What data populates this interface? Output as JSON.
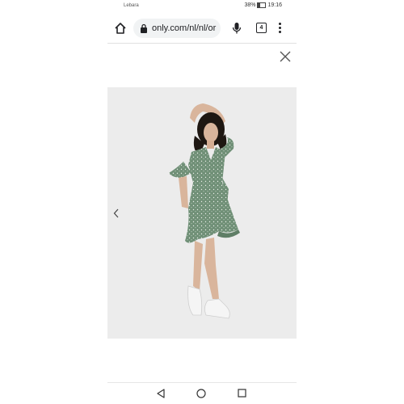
{
  "status_bar": {
    "carrier": "Lebara",
    "battery": "38%",
    "time": "19:16"
  },
  "toolbar": {
    "url": "only.com/nl/nl/or",
    "tab_count": "4"
  },
  "lightbox": {
    "image_alt": "Model wearing a green patterned wrap dress with ruffled sleeves and white sneakers"
  },
  "colors": {
    "dress": "#6f8f76",
    "background": "#ececec",
    "accent": "#202124"
  },
  "icons": [
    "home-icon",
    "lock-icon",
    "mic-icon",
    "tabs-icon",
    "menu-icon",
    "close-icon",
    "chevron-left-icon",
    "nav-back-icon",
    "nav-home-icon",
    "nav-recent-icon"
  ]
}
